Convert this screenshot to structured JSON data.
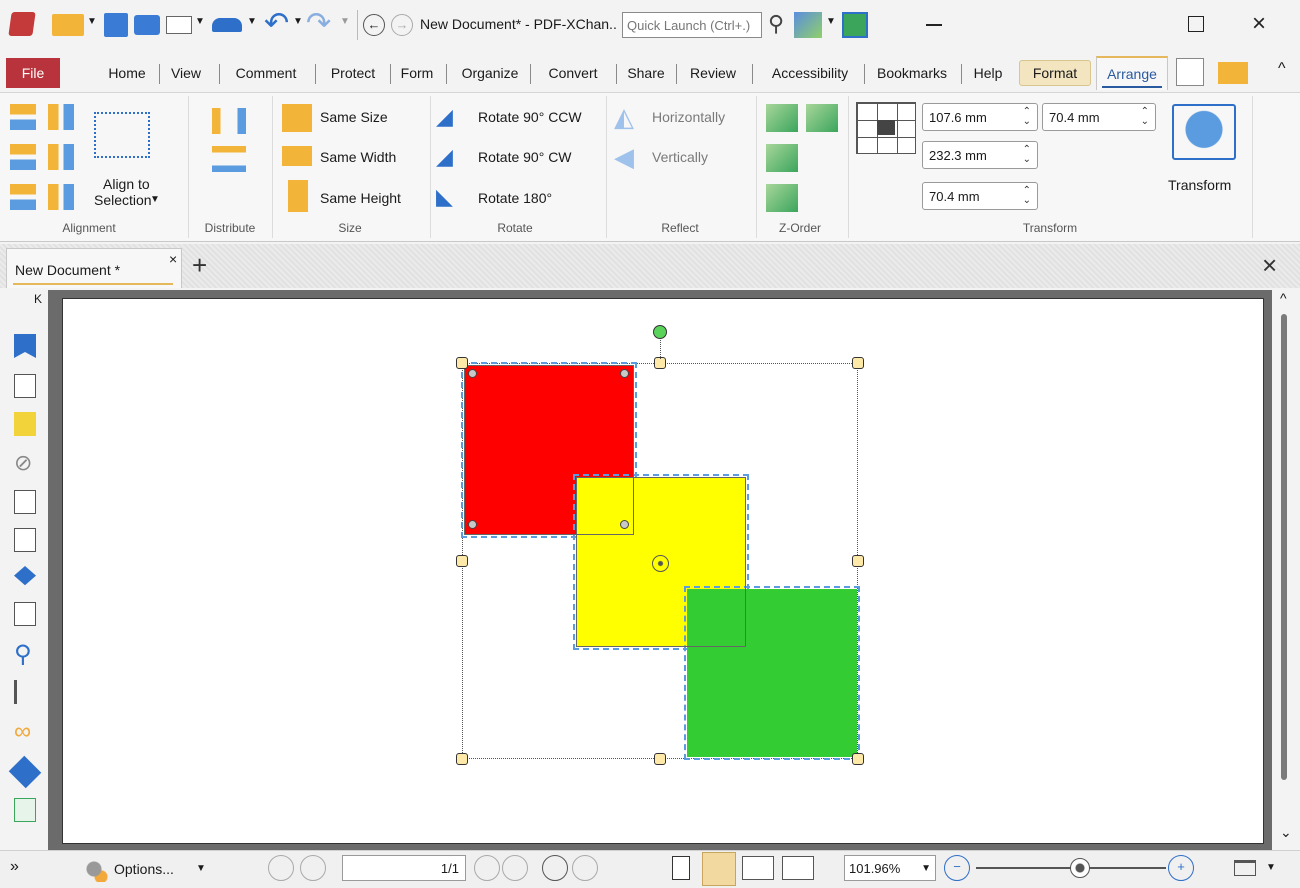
{
  "window": {
    "title": "New Document* - PDF-XChan..",
    "quick_launch_placeholder": "Quick Launch (Ctrl+.)"
  },
  "menu": {
    "file": "File",
    "items": [
      "Home",
      "View",
      "Comment",
      "Protect",
      "Form",
      "Organize",
      "Convert",
      "Share",
      "Review",
      "Accessibility",
      "Bookmarks",
      "Help",
      "Format",
      "Arrange"
    ]
  },
  "ribbon": {
    "alignment": {
      "label": "Alignment",
      "align_to_selection_line1": "Align to",
      "align_to_selection_line2": "Selection"
    },
    "distribute": {
      "label": "Distribute"
    },
    "size": {
      "label": "Size",
      "same_size": "Same Size",
      "same_width": "Same Width",
      "same_height": "Same Height"
    },
    "rotate": {
      "label": "Rotate",
      "ccw": "Rotate 90° CCW",
      "cw": "Rotate 90° CW",
      "r180": "Rotate 180°"
    },
    "reflect": {
      "label": "Reflect",
      "horizontally": "Horizontally",
      "vertically": "Vertically"
    },
    "zorder": {
      "label": "Z-Order"
    },
    "transform": {
      "label": "Transform",
      "x": "107.6 mm",
      "y": "70.4 mm",
      "width": "232.3 mm",
      "height": "70.4 mm",
      "button": "Transform"
    }
  },
  "tabs": {
    "doc_tab": "New Document *",
    "close": "×",
    "new_tab": "+",
    "close_all": "×"
  },
  "statusbar": {
    "options": "Options...",
    "page_indicator": "1/1",
    "zoom": "101.96%"
  },
  "colors": {
    "red": "#ff0000",
    "yellow": "#ffff00",
    "green": "#33cc33",
    "accent": "#b8333b"
  }
}
